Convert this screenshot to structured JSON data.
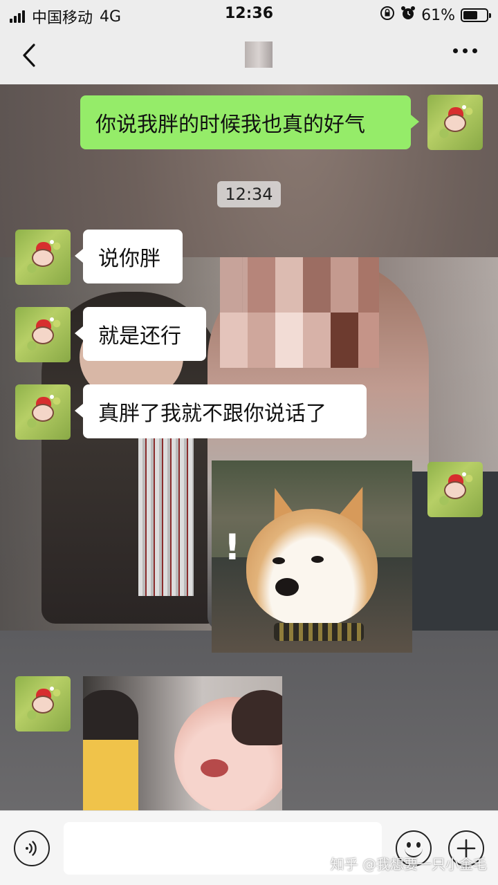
{
  "status_bar": {
    "carrier": "中国移动",
    "network": "4G",
    "time": "12:36",
    "battery_percent_text": "61%",
    "battery_level": 0.61,
    "icons": [
      "signal-icon",
      "orientation-lock-icon",
      "alarm-icon",
      "battery-icon"
    ]
  },
  "nav": {
    "back_icon": "chevron-left-icon",
    "more_icon": "more-dots-icon"
  },
  "messages": [
    {
      "side": "right",
      "type": "text",
      "text": "你说我胖的时候我也真的好气"
    },
    {
      "side": "center",
      "type": "time",
      "text": "12:34"
    },
    {
      "side": "left",
      "type": "text",
      "text": "说你胖"
    },
    {
      "side": "left",
      "type": "text",
      "text": "就是还行"
    },
    {
      "side": "left",
      "type": "text",
      "text": "真胖了我就不跟你说话了"
    },
    {
      "side": "right",
      "type": "sticker",
      "text": "!"
    },
    {
      "side": "left",
      "type": "sticker"
    }
  ],
  "input_bar": {
    "voice_icon": "voice-icon",
    "emoji_icon": "emoji-icon",
    "plus_icon": "plus-icon",
    "placeholder": ""
  },
  "watermark": "知乎 @我想要一只小金毛",
  "colors": {
    "sent_bubble": "#95ec69",
    "received_bubble": "#ffffff",
    "bar_background": "#ededed"
  }
}
